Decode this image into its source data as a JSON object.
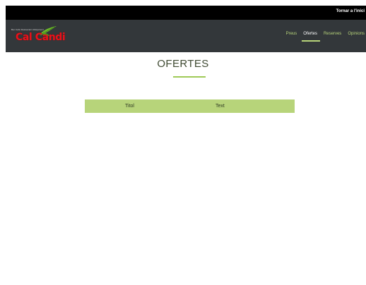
{
  "topbar": {
    "back_link": "Tornar a l'inici"
  },
  "logo": {
    "tagline": "Bar Cafè Restaurant Allotjament",
    "name": "Cal Candi"
  },
  "nav": {
    "items": [
      {
        "label": "Preus",
        "active": false
      },
      {
        "label": "Ofertes",
        "active": true
      },
      {
        "label": "Reserves",
        "active": false
      },
      {
        "label": "Opinions",
        "active": false
      }
    ]
  },
  "main": {
    "title": "OFERTES",
    "table": {
      "columns": [
        "Titol",
        "Text"
      ]
    }
  },
  "colors": {
    "topbar": "#000000",
    "navbar": "#33373a",
    "accent": "#b7d47a",
    "logo_red": "#e8121b",
    "title": "#3f4a32"
  }
}
